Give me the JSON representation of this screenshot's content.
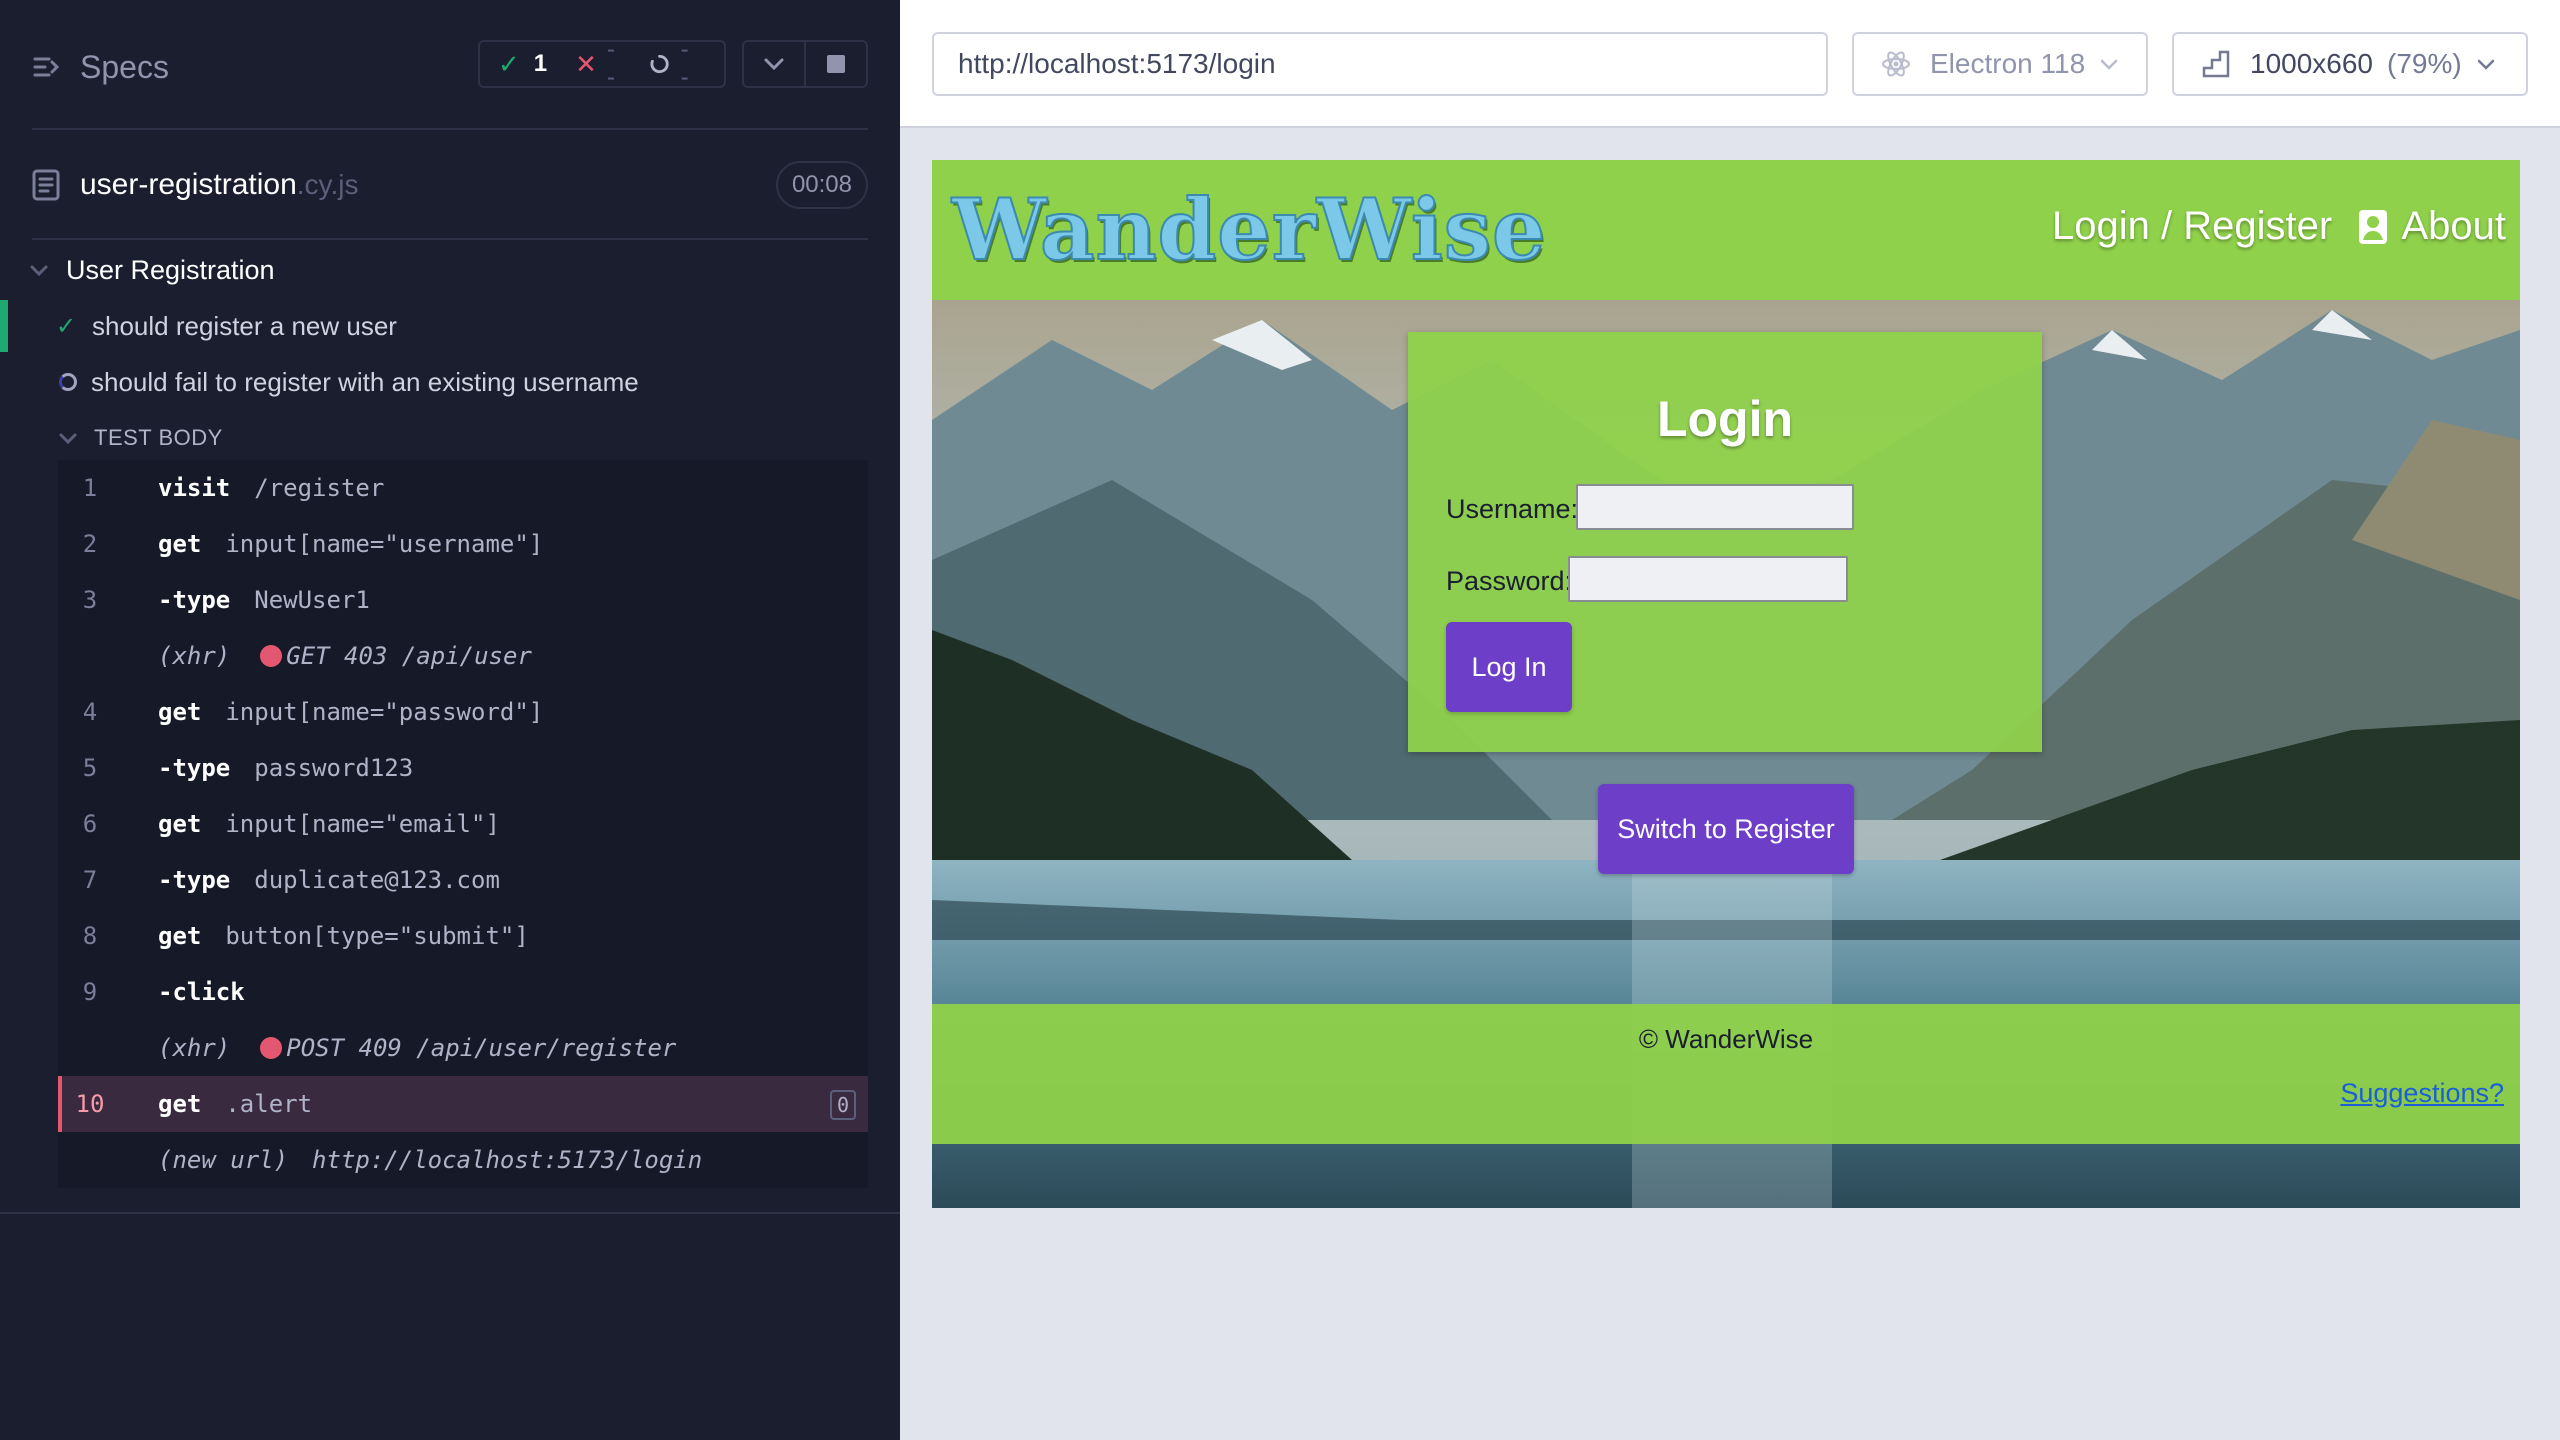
{
  "runner": {
    "specs_title": "Specs",
    "stats": {
      "passed": "1",
      "failed": "--",
      "pending": "--"
    },
    "file": {
      "name": "user-registration",
      "ext": ".cy.js",
      "duration": "00:08"
    },
    "suite": {
      "title": "User Registration"
    },
    "tests": [
      {
        "title": "should register a new user",
        "state": "passed"
      },
      {
        "title": "should fail to register with an existing username",
        "state": "running"
      }
    ],
    "test_body_label": "TEST BODY",
    "commands": [
      {
        "num": "1",
        "name": "visit",
        "arg": "/register"
      },
      {
        "num": "2",
        "name": "get",
        "arg": "input[name=\"username\"]"
      },
      {
        "num": "3",
        "name": "-type",
        "arg": "NewUser1"
      },
      {
        "xhr_label": "(xhr)",
        "xhr_text": "GET 403 /api/user"
      },
      {
        "num": "4",
        "name": "get",
        "arg": "input[name=\"password\"]"
      },
      {
        "num": "5",
        "name": "-type",
        "arg": "password123"
      },
      {
        "num": "6",
        "name": "get",
        "arg": "input[name=\"email\"]"
      },
      {
        "num": "7",
        "name": "-type",
        "arg": "duplicate@123.com"
      },
      {
        "num": "8",
        "name": "get",
        "arg": "button[type=\"submit\"]"
      },
      {
        "num": "9",
        "name": "-click",
        "arg": ""
      },
      {
        "xhr_label": "(xhr)",
        "xhr_text": "POST 409 /api/user/register"
      },
      {
        "num": "10",
        "name": "get",
        "arg": ".alert",
        "count": "0"
      },
      {
        "new_url_label": "(new url)",
        "new_url": "http://localhost:5173/login"
      }
    ]
  },
  "browser_bar": {
    "url": "http://localhost:5173/login",
    "browser": "Electron 118",
    "viewport": "1000x660",
    "zoom": "(79%)"
  },
  "app": {
    "brand": "WanderWise",
    "nav_login": "Login / Register",
    "nav_about": "About",
    "login": {
      "title": "Login",
      "username_label": "Username:",
      "password_label": "Password:",
      "submit_label": "Log In"
    },
    "switch_label": "Switch to Register",
    "footer": {
      "copyright": "© WanderWise",
      "suggestions": "Suggestions?"
    }
  },
  "colors": {
    "panel_bg": "#1b1e2e",
    "pass": "#1fa971",
    "fail": "#e45770",
    "app_green": "#8fd14a",
    "app_purple": "#6d3ec8",
    "link_blue": "#1a5fd8"
  }
}
